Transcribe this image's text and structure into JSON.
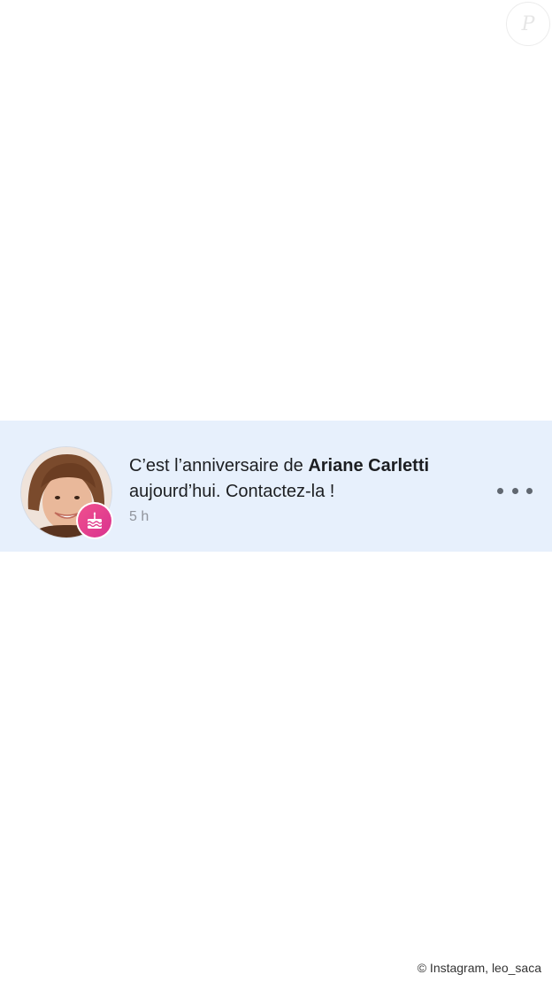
{
  "watermark": {
    "label": "P"
  },
  "notification": {
    "text_before": "C’est l’anniversaire de ",
    "person_name": "Ariane Carletti",
    "text_after": " aujourd’hui. Contactez-la !",
    "timestamp": "5 h",
    "avatar": "profile-photo",
    "badge_icon": "birthday-cake-icon",
    "more_icon": "more-horizontal-icon",
    "background_color": "#e7f0fc",
    "badge_color": "#e2408f"
  },
  "credit": {
    "text": "© Instagram, leo_saca"
  }
}
